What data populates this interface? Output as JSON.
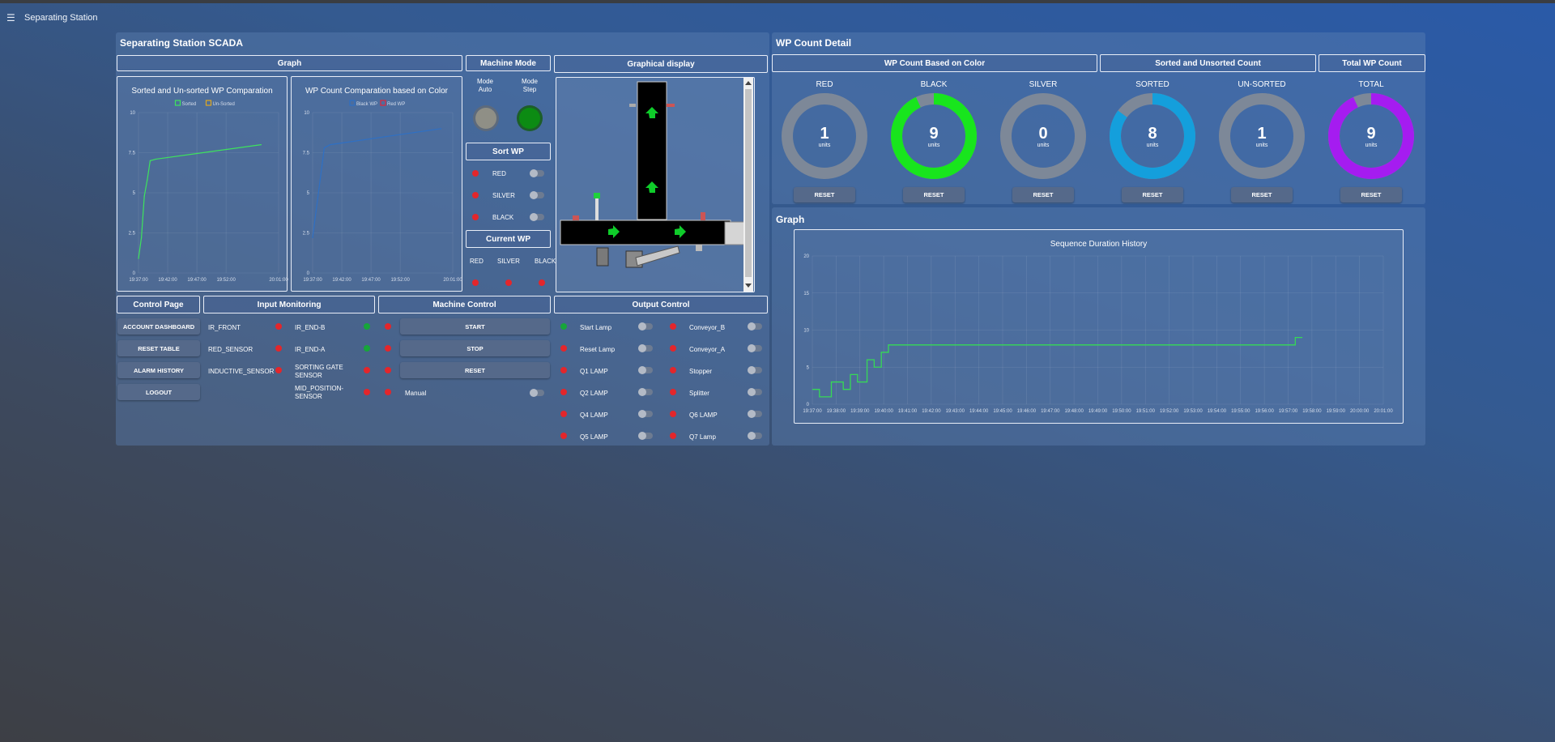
{
  "app": {
    "title": "Separating Station"
  },
  "scada": {
    "title": "Separating Station SCADA",
    "headers": {
      "graph": "Graph",
      "machine_mode": "Machine Mode",
      "graphical_display": "Graphical display",
      "control_page": "Control Page",
      "input_monitoring": "Input Monitoring",
      "machine_control": "Machine Control",
      "output_control": "Output Control"
    },
    "chart1": {
      "title": "Sorted and Un-sorted WP Comparation",
      "legend": [
        "Sorted",
        "Un-Sorted"
      ],
      "y_ticks": [
        "10",
        "7.5",
        "5",
        "2.5",
        "0"
      ],
      "x_ticks": [
        "19:37:00",
        "19:42:00",
        "19:47:00",
        "19:52:00",
        "20:01:00"
      ]
    },
    "chart2": {
      "title": "WP Count Comparation based on Color",
      "legend": [
        "Black WP",
        "Red WP"
      ],
      "y_ticks": [
        "10",
        "7.5",
        "5",
        "2.5",
        "0"
      ],
      "x_ticks": [
        "19:37:00",
        "19:42:00",
        "19:47:00",
        "19:52:00",
        "20:01:00"
      ]
    },
    "mode": {
      "auto_label": "Mode\nAuto",
      "step_label": "Mode\nStep",
      "auto_active": false,
      "step_active": true
    },
    "sort_wp": {
      "title": "Sort WP",
      "items": [
        "RED",
        "SILVER",
        "BLACK"
      ]
    },
    "current_wp": {
      "title": "Current WP",
      "items": [
        "RED",
        "SILVER",
        "BLACK"
      ]
    },
    "control_page": {
      "buttons": [
        "ACCOUNT DASHBOARD",
        "RESET TABLE",
        "ALARM HISTORY",
        "LOGOUT"
      ]
    },
    "input_monitoring": {
      "left": [
        {
          "label": "IR_FRONT",
          "status": "red"
        },
        {
          "label": "RED_SENSOR",
          "status": "red"
        },
        {
          "label": "INDUCTIVE_SENSOR",
          "status": "red"
        }
      ],
      "right": [
        {
          "label": "IR_END-B",
          "status1": "green",
          "status2": "red"
        },
        {
          "label": "IR_END-A",
          "status1": "green",
          "status2": "red"
        },
        {
          "label": "SORTING GATE SENSOR",
          "status1": "red",
          "status2": "red"
        },
        {
          "label": "MID_POSITION-SENSOR",
          "status1": "red",
          "status2": "red"
        }
      ]
    },
    "machine_control": {
      "buttons": [
        "START",
        "STOP",
        "RESET"
      ],
      "manual_label": "Manual"
    },
    "output_control": {
      "left": [
        {
          "label": "Start Lamp",
          "status": "green"
        },
        {
          "label": "Reset Lamp",
          "status": "red"
        },
        {
          "label": "Q1 LAMP",
          "status": "red"
        },
        {
          "label": "Q2 LAMP",
          "status": "red"
        },
        {
          "label": "Q4 LAMP",
          "status": "red"
        },
        {
          "label": "Q5 LAMP",
          "status": "red"
        }
      ],
      "right": [
        {
          "label": "Conveyor_B",
          "status": "red"
        },
        {
          "label": "Conveyor_A",
          "status": "red"
        },
        {
          "label": "Stopper",
          "status": "red"
        },
        {
          "label": "Splitter",
          "status": "red"
        },
        {
          "label": "Q6 LAMP",
          "status": "red"
        },
        {
          "label": "Q7 Lamp",
          "status": "red"
        }
      ]
    }
  },
  "wp_detail": {
    "title": "WP Count Detail",
    "headers": {
      "color": "WP Count Based on Color",
      "sorted": "Sorted and Unsorted Count",
      "total": "Total WP Count"
    },
    "reset_label": "RESET",
    "unit_label": "units",
    "gauges": [
      {
        "label": "RED",
        "value": "1",
        "fraction": 0.111,
        "color": "#7d8898"
      },
      {
        "label": "BLACK",
        "value": "9",
        "fraction": 0.93,
        "color": "#18e51d"
      },
      {
        "label": "SILVER",
        "value": "0",
        "fraction": 0,
        "color": "#7d8898"
      },
      {
        "label": "SORTED",
        "value": "8",
        "fraction": 0.85,
        "color": "#149fdc"
      },
      {
        "label": "UN-SORTED",
        "value": "1",
        "fraction": 0.111,
        "color": "#7d8898"
      },
      {
        "label": "TOTAL",
        "value": "9",
        "fraction": 0.93,
        "color": "#a51cf0"
      }
    ]
  },
  "graph": {
    "title": "Graph",
    "chart_title": "Sequence Duration History",
    "y_ticks": [
      "20",
      "15",
      "10",
      "5",
      "0"
    ],
    "x_ticks": [
      "19:37:00",
      "19:38:00",
      "19:39:00",
      "19:40:00",
      "19:41:00",
      "19:42:00",
      "19:43:00",
      "19:44:00",
      "19:45:00",
      "19:46:00",
      "19:47:00",
      "19:48:00",
      "19:49:00",
      "19:50:00",
      "19:51:00",
      "19:52:00",
      "19:53:00",
      "19:54:00",
      "19:55:00",
      "19:56:00",
      "19:57:00",
      "19:58:00",
      "19:59:00",
      "20:00:00",
      "20:01:00"
    ]
  },
  "chart_data": [
    {
      "type": "line",
      "title": "Sorted and Un-sorted WP Comparation",
      "xlabel": "",
      "ylabel": "",
      "ylim": [
        0,
        10
      ],
      "x_ticks": [
        "19:37:00",
        "19:42:00",
        "19:47:00",
        "19:52:00",
        "20:01:00"
      ],
      "series": [
        {
          "name": "Sorted",
          "color": "#3ee35d",
          "x": [
            "19:37:00",
            "19:37:30",
            "19:38:00",
            "19:38:30",
            "19:39:00",
            "19:40:00",
            "19:58:00"
          ],
          "y": [
            0.9,
            2.2,
            4.8,
            5.8,
            7.0,
            7.1,
            8.0
          ]
        },
        {
          "name": "Un-Sorted",
          "color": "#e0a820",
          "x": [],
          "y": []
        }
      ],
      "grid": true,
      "legend": "top"
    },
    {
      "type": "line",
      "title": "WP Count Comparation based on Color",
      "xlabel": "",
      "ylabel": "",
      "ylim": [
        0,
        10
      ],
      "x_ticks": [
        "19:37:00",
        "19:42:00",
        "19:47:00",
        "19:52:00",
        "20:01:00"
      ],
      "series": [
        {
          "name": "Black WP",
          "color": "#2f70c4",
          "x": [
            "19:37:00",
            "19:39:00",
            "19:40:00",
            "19:59:00"
          ],
          "y": [
            2.2,
            7.8,
            8.0,
            9.0
          ]
        },
        {
          "name": "Red WP",
          "color": "#e0263a",
          "x": [],
          "y": []
        }
      ],
      "grid": true,
      "legend": "top"
    },
    {
      "type": "line",
      "title": "Sequence Duration History",
      "xlabel": "",
      "ylabel": "",
      "ylim": [
        0,
        20
      ],
      "x_ticks": [
        "19:37:00",
        "19:38:00",
        "19:39:00",
        "19:40:00",
        "19:41:00",
        "19:42:00",
        "19:43:00",
        "19:44:00",
        "19:45:00",
        "19:46:00",
        "19:47:00",
        "19:48:00",
        "19:49:00",
        "19:50:00",
        "19:51:00",
        "19:52:00",
        "19:53:00",
        "19:54:00",
        "19:55:00",
        "19:56:00",
        "19:57:00",
        "19:58:00",
        "19:59:00",
        "20:00:00",
        "20:01:00"
      ],
      "series": [
        {
          "name": "",
          "color": "#36d956",
          "x": [
            0.0,
            0.3,
            0.3,
            0.8,
            0.8,
            1.3,
            1.3,
            1.6,
            1.6,
            1.9,
            1.9,
            2.3,
            2.3,
            2.6,
            2.6,
            2.9,
            2.9,
            3.2,
            3.2,
            20.3,
            20.3,
            20.6
          ],
          "y": [
            2,
            2,
            1,
            1,
            3,
            3,
            2,
            2,
            4,
            4,
            3,
            3,
            6,
            6,
            5,
            5,
            7,
            7,
            8,
            8,
            9,
            9
          ]
        }
      ],
      "grid": true,
      "legend": "none"
    }
  ]
}
